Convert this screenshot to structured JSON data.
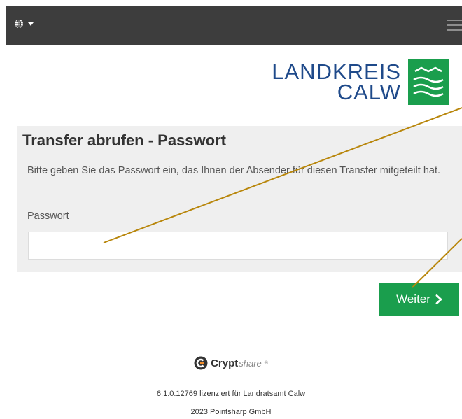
{
  "navbar": {
    "language_icon": "globe-icon",
    "menu_icon": "hamburger-menu-icon"
  },
  "logo": {
    "line1": "LANDKREIS",
    "line2": "CALW",
    "color": "#1f4a8a",
    "mark_color": "#1a9e4d"
  },
  "card": {
    "title": "Transfer abrufen - Passwort",
    "description": "Bitte geben Sie das Passwort ein, das Ihnen der Absender für diesen Transfer mitgeteilt hat.",
    "password_label": "Passwort",
    "password_value": "",
    "password_placeholder": ""
  },
  "actions": {
    "next_label": "Weiter",
    "next_icon": "chevron-right-icon",
    "color": "#1a9e4d"
  },
  "footer": {
    "brand_bold": "Crypt",
    "brand_light": "share",
    "brand_mark": "®",
    "license": "6.1.0.12769 lizenziert für Landratsamt Calw",
    "copyright": "2023 Pointsharp GmbH"
  }
}
